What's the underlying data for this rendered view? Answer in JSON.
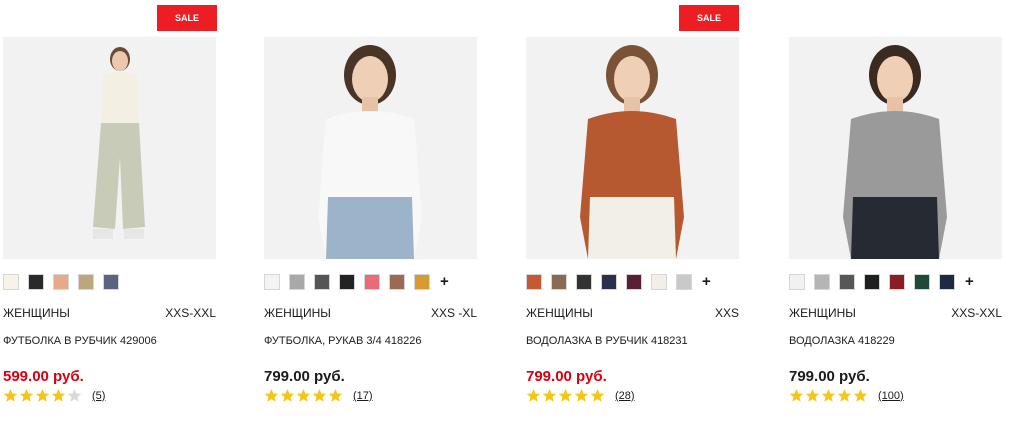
{
  "colors": {
    "sale_red": "#ed1d24",
    "sale_price": "#d8000f",
    "star_filled": "#f5c518",
    "star_empty": "#d9d9d9"
  },
  "products": [
    {
      "sale_badge": "SALE",
      "swatches": [
        "#f7f3e8",
        "#2a2a2a",
        "#e8a98a",
        "#bca77d",
        "#5b6380"
      ],
      "more": "",
      "gender": "ЖЕНЩИНЫ",
      "sizes": "XXS-XXL",
      "name": "ФУТБОЛКА В РУБЧИК 429006",
      "price": "599.00 руб.",
      "is_sale": true,
      "rating": 4,
      "reviews": "(5)",
      "photo": {
        "top_color": "#f3efe2",
        "bottom_color": "#c9cbb9",
        "hair_color": "#6b4a33",
        "pose": "full"
      }
    },
    {
      "sale_badge": "",
      "swatches": [
        "#f4f4f4",
        "#a8a8a8",
        "#555555",
        "#222222",
        "#e86b7a",
        "#9b6a52",
        "#d89b2f"
      ],
      "more": "+",
      "gender": "ЖЕНЩИНЫ",
      "sizes": "XXS -XL",
      "name": "ФУТБОЛКА, РУКАВ 3/4 418226",
      "price": "799.00 руб.",
      "is_sale": false,
      "rating": 5,
      "reviews": "(17)",
      "photo": {
        "top_color": "#f8f8f8",
        "bottom_color": "#9db3c9",
        "hair_color": "#4a3426",
        "pose": "half"
      }
    },
    {
      "sale_badge": "SALE",
      "swatches": [
        "#c55a32",
        "#8a6a52",
        "#333333",
        "#2b2f4e",
        "#5a1f36",
        "#f1efe6",
        "#c9c9c9"
      ],
      "more": "+",
      "gender": "ЖЕНЩИНЫ",
      "sizes": "XXS",
      "name": "ВОДОЛАЗКА В РУБЧИК 418231",
      "price": "799.00 руб.",
      "is_sale": true,
      "rating": 5,
      "reviews": "(28)",
      "photo": {
        "top_color": "#b65830",
        "bottom_color": "#f2efe6",
        "hair_color": "#7a5236",
        "pose": "half"
      }
    },
    {
      "sale_badge": "",
      "swatches": [
        "#f1f1f1",
        "#b5b5b5",
        "#575757",
        "#1f1f1f",
        "#8a1c24",
        "#1f4a3a",
        "#1e2a44"
      ],
      "more": "+",
      "gender": "ЖЕНЩИНЫ",
      "sizes": "XXS-XXL",
      "name": "ВОДОЛАЗКА 418229",
      "price": "799.00 руб.",
      "is_sale": false,
      "rating": 5,
      "reviews": "(100)",
      "photo": {
        "top_color": "#9a9a9a",
        "bottom_color": "#262a33",
        "hair_color": "#3b2a20",
        "pose": "half"
      }
    }
  ]
}
